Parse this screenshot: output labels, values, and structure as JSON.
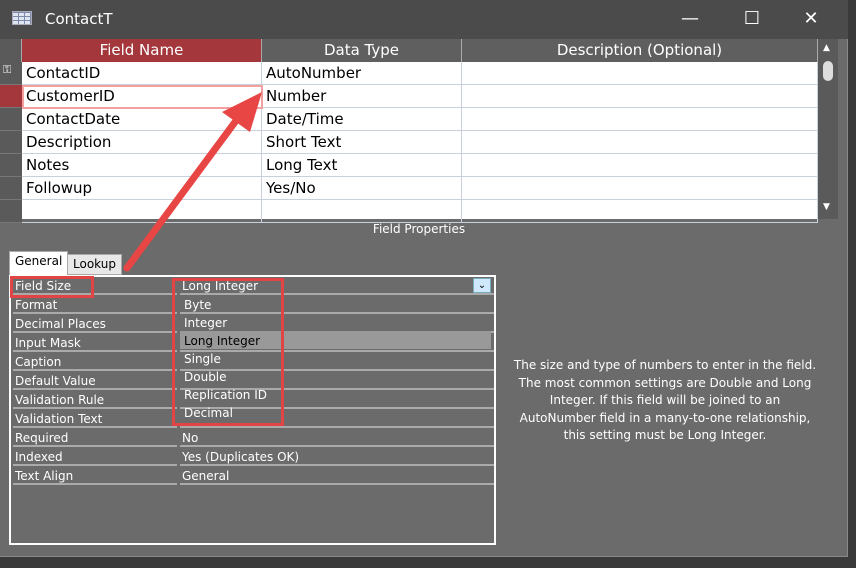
{
  "window": {
    "title": "ContactT",
    "minimize": "—",
    "maximize": "☐",
    "close": "✕"
  },
  "grid": {
    "headers": [
      "Field Name",
      "Data Type",
      "Description (Optional)"
    ],
    "rows": [
      {
        "name": "ContactID",
        "type": "AutoNumber"
      },
      {
        "name": "CustomerID",
        "type": "Number"
      },
      {
        "name": "ContactDate",
        "type": "Date/Time"
      },
      {
        "name": "Description",
        "type": "Short Text"
      },
      {
        "name": "Notes",
        "type": "Long Text"
      },
      {
        "name": "Followup",
        "type": "Yes/No"
      }
    ]
  },
  "field_properties_label": "Field Properties",
  "tabs": [
    "General",
    "Lookup"
  ],
  "properties": [
    {
      "label": "Field Size",
      "value": "Long Integer"
    },
    {
      "label": "Format",
      "value": ""
    },
    {
      "label": "Decimal Places",
      "value": ""
    },
    {
      "label": "Input Mask",
      "value": ""
    },
    {
      "label": "Caption",
      "value": ""
    },
    {
      "label": "Default Value",
      "value": ""
    },
    {
      "label": "Validation Rule",
      "value": ""
    },
    {
      "label": "Validation Text",
      "value": ""
    },
    {
      "label": "Required",
      "value": "No"
    },
    {
      "label": "Indexed",
      "value": "Yes (Duplicates OK)"
    },
    {
      "label": "Text Align",
      "value": "General"
    }
  ],
  "dropdown": {
    "options": [
      "Byte",
      "Integer",
      "Long Integer",
      "Single",
      "Double",
      "Replication ID",
      "Decimal"
    ],
    "highlighted": "Long Integer"
  },
  "help_text": "The size and type of numbers to enter in the field. The most common settings are Double and Long Integer. If this field will be joined to an AutoNumber field in a many-to-one relationship, this setting must be Long Integer.",
  "colors": {
    "accent": "#a3373b",
    "annotation": "#e84545"
  }
}
